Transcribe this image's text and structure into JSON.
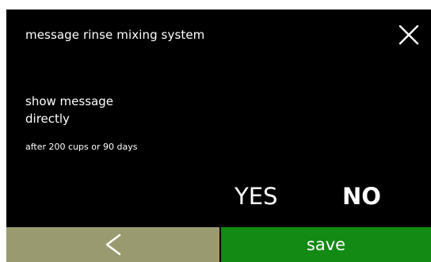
{
  "header": {
    "title": "message rinse mixing system",
    "close_icon": "close-icon"
  },
  "content": {
    "message": "show message\ndirectly",
    "hint": "after 200 cups or 90 days"
  },
  "options": {
    "yes_label": "YES",
    "no_label": "NO",
    "selected": "NO"
  },
  "footer": {
    "back_icon": "chevron-left-icon",
    "save_label": "save"
  },
  "colors": {
    "background": "#000000",
    "text": "#ffffff",
    "back_button": "#999a70",
    "save_button": "#128a14"
  }
}
